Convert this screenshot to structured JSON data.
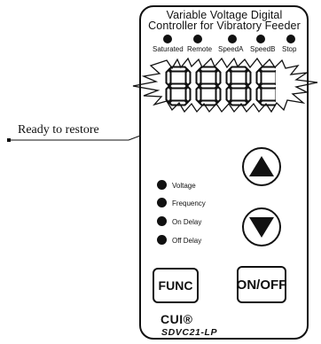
{
  "title_line1": "Variable Voltage Digital",
  "title_line2": "Controller for Vibratory Feeder",
  "status_indicators": [
    "Saturated",
    "Remote",
    "SpeedA",
    "SpeedB",
    "Stop"
  ],
  "display": {
    "value": "8888",
    "color": "#111111"
  },
  "callout": "Ready to restore",
  "mode_indicators": [
    "Voltage",
    "Frequency",
    "On Delay",
    "Off Delay"
  ],
  "buttons": {
    "up": "up-arrow-icon",
    "down": "down-arrow-icon",
    "func": "FUNC",
    "onoff": "ON/OFF"
  },
  "brand": "CUI®",
  "model": "SDVC21-LP"
}
